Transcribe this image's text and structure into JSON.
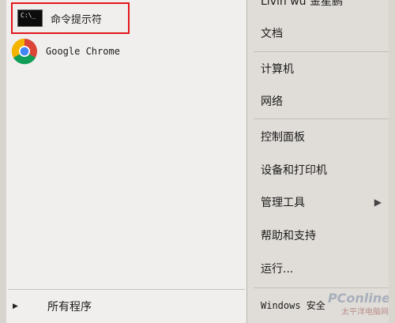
{
  "programs": [
    {
      "label": "命令提示符",
      "icon": "cmd-icon",
      "icon_text": "C:\\_"
    },
    {
      "label": "Google Chrome",
      "icon": "chrome-icon"
    }
  ],
  "all_programs": {
    "label": "所有程序"
  },
  "right_menu": {
    "partial_top": "Livin wu 金星鹏",
    "items": [
      {
        "label": "文档"
      },
      {
        "label": "计算机"
      },
      {
        "label": "网络"
      },
      {
        "label": "控制面板"
      },
      {
        "label": "设备和打印机"
      },
      {
        "label": "管理工具"
      },
      {
        "label": "帮助和支持"
      },
      {
        "label": "运行..."
      }
    ],
    "bottom": "Windows 安全"
  },
  "watermark": {
    "brand": "PConline",
    "sub": "太平洋电脑网"
  },
  "colors": {
    "highlight_border": "#e3161b",
    "left_bg": "#f0efed",
    "right_bg": "#e0ddd8"
  }
}
